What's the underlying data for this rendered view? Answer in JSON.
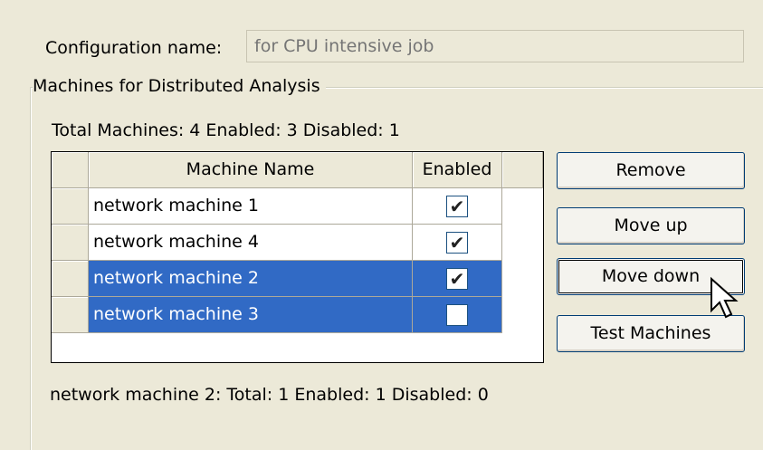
{
  "config": {
    "label": "Configuration name:",
    "placeholder": "for CPU intensive job"
  },
  "group": {
    "title": "Machines for Distributed Analysis",
    "totals": "Total Machines: 4   Enabled: 3   Disabled: 1"
  },
  "grid": {
    "columns": {
      "name": "Machine Name",
      "enabled": "Enabled"
    },
    "rows": [
      {
        "name": "network machine 1",
        "enabled": true,
        "selected": false
      },
      {
        "name": "network machine 4",
        "enabled": true,
        "selected": false
      },
      {
        "name": "network machine 2",
        "enabled": true,
        "selected": true
      },
      {
        "name": "network machine 3",
        "enabled": false,
        "selected": true
      }
    ]
  },
  "buttons": {
    "remove": "Remove",
    "move_up": "Move up",
    "move_down": "Move down",
    "test": "Test Machines"
  },
  "status": "network machine 2:   Total: 1   Enabled: 1   Disabled: 0",
  "colors": {
    "selection": "#316ac5",
    "background": "#ece9d8"
  }
}
